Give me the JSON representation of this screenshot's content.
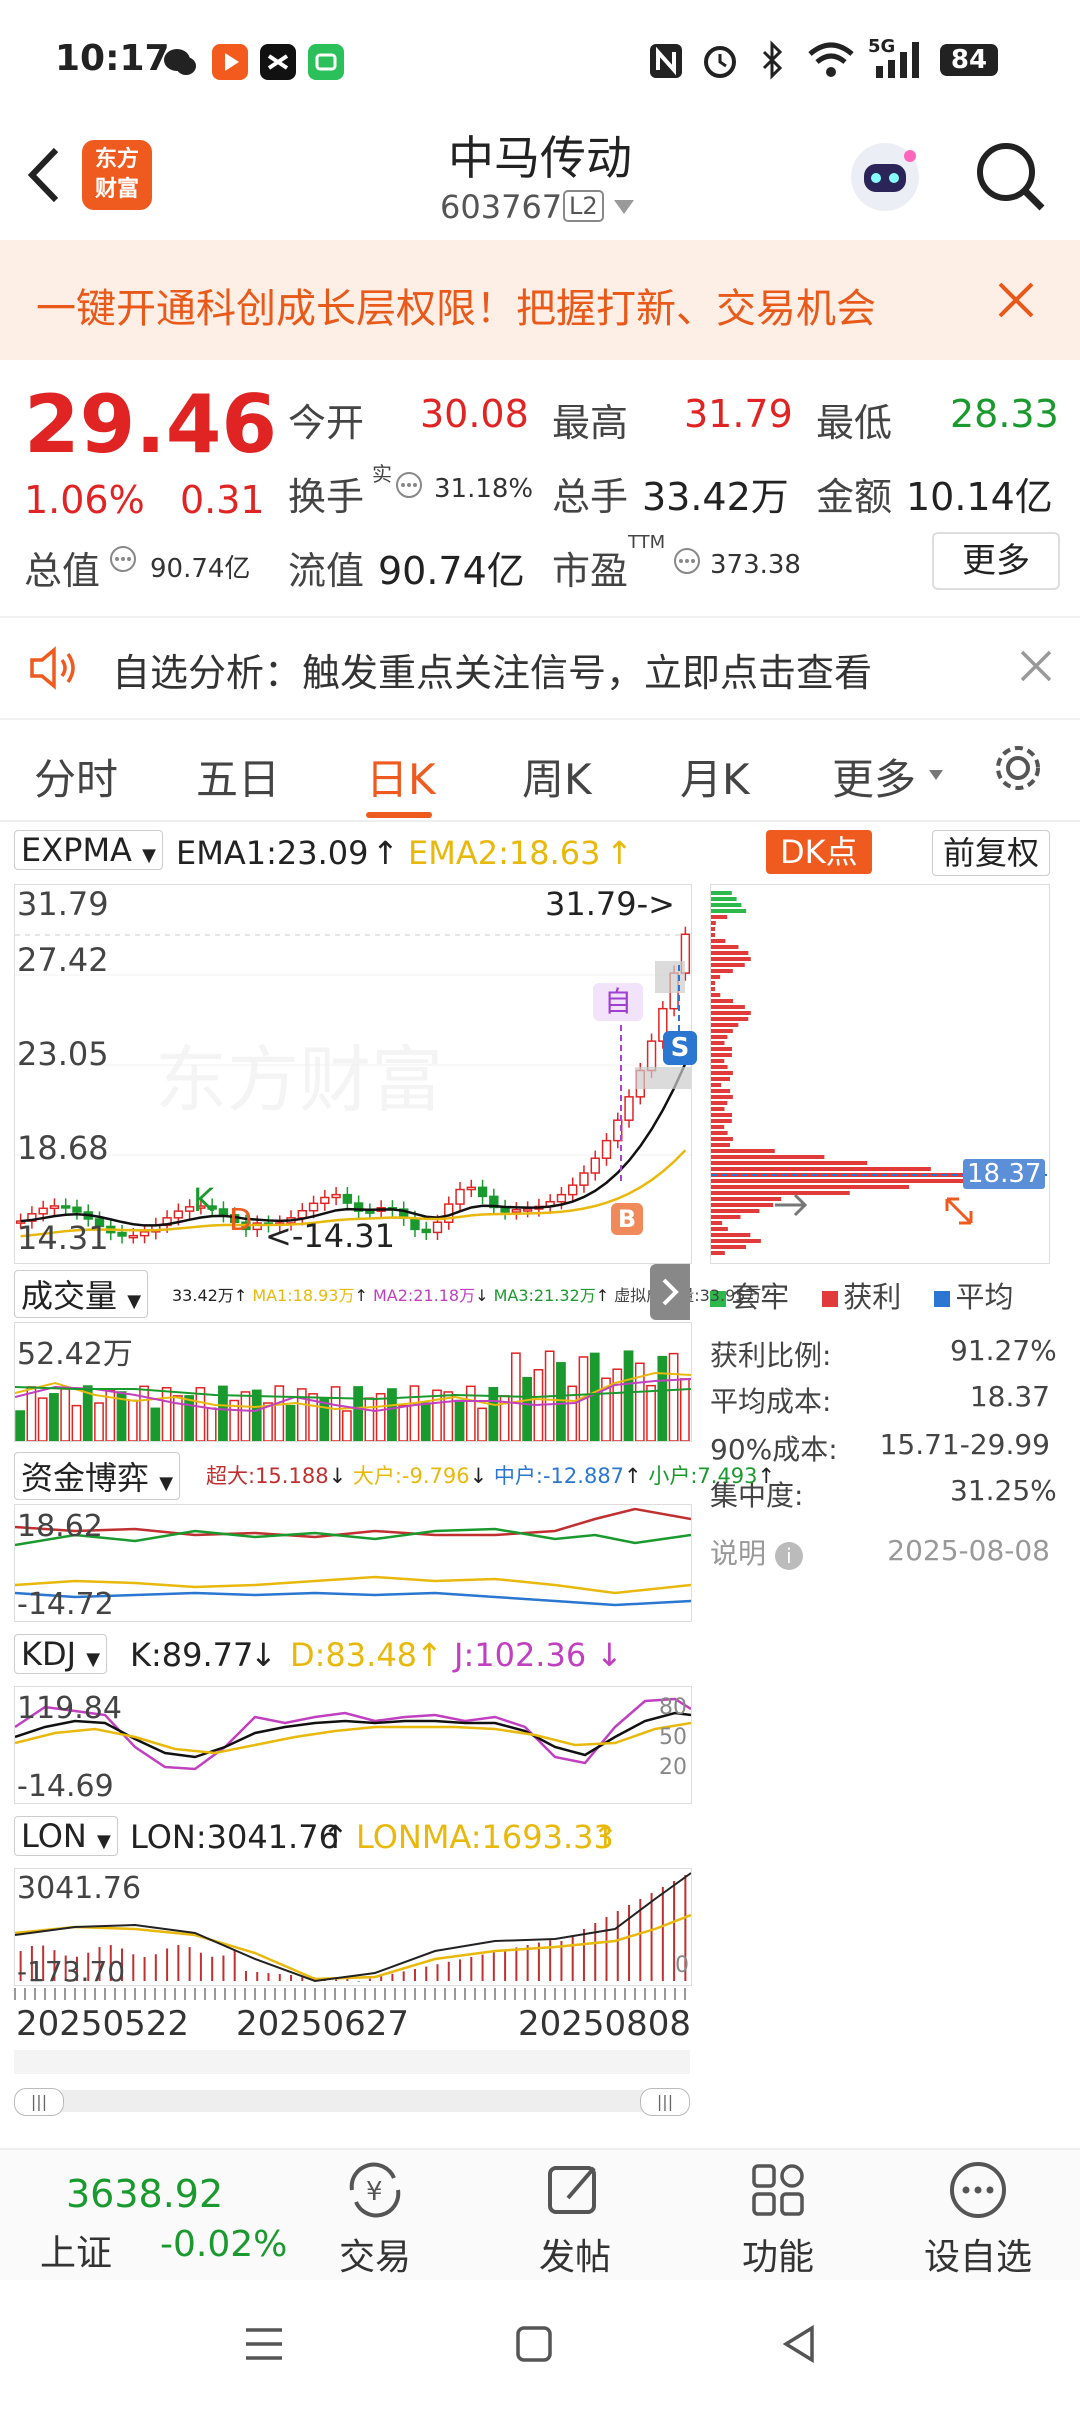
{
  "status_bar": {
    "time": "10:17",
    "battery": "84",
    "network": "5G"
  },
  "header": {
    "logo_text_1": "东方",
    "logo_text_2": "财富",
    "title": "中马传动",
    "code": "603767",
    "badge": "L2"
  },
  "banner": {
    "text": "一键开通科创成长层权限！把握打新、交易机会"
  },
  "quote": {
    "price": "29.46",
    "change_pct": "1.06%",
    "change": "0.31",
    "open_label": "今开",
    "open": "30.08",
    "high_label": "最高",
    "high": "31.79",
    "low_label": "最低",
    "low": "28.33",
    "turnover_label": "换手",
    "turnover_sup": "实",
    "turnover": "31.18%",
    "volume_label": "总手",
    "volume": "33.42万",
    "amount_label": "金额",
    "amount": "10.14亿",
    "mktcap_label": "总值",
    "mktcap": "90.74亿",
    "float_label": "流值",
    "float": "90.74亿",
    "pe_label": "市盈",
    "pe_sup": "TTM",
    "pe": "373.38",
    "more": "更多"
  },
  "notice": {
    "text": "自选分析：触发重点关注信号，立即点击查看"
  },
  "tabs": [
    "分时",
    "五日",
    "日K",
    "周K",
    "月K",
    "更多"
  ],
  "main_chart": {
    "indicator": "EXPMA",
    "ema1": "EMA1:23.09",
    "ema2": "EMA2:18.63",
    "dk_btn": "DK点",
    "adj_btn": "前复权",
    "y_labels": [
      "31.79",
      "27.42",
      "23.05",
      "18.68",
      "14.31"
    ],
    "max_tag": "31.79->",
    "min_tag": "<-14.31",
    "watermark": "东方财富",
    "tag_self": "自",
    "tag_s": "S",
    "tag_b": "B",
    "tag_k": "K",
    "tag_d": "D"
  },
  "chip": {
    "avg_tag": "18.37",
    "legend": [
      "套牢",
      "获利",
      "平均"
    ],
    "rows": [
      {
        "label": "获利比例:",
        "value": "91.27%"
      },
      {
        "label": "平均成本:",
        "value": "18.37"
      },
      {
        "label": "90%成本:",
        "value": "15.71-29.99"
      },
      {
        "label": "集中度:",
        "value": "31.25%"
      }
    ],
    "note": "说明",
    "date": "2025-08-08"
  },
  "volume": {
    "label": "成交量",
    "vals": [
      "33.42万",
      "MA1:18.93万",
      "MA2:21.18万",
      "MA3:21.32万",
      "虚拟成交量:33.95万"
    ],
    "ylab": "52.42万"
  },
  "fund": {
    "label": "资金博弈",
    "vals": [
      "超大:15.188",
      "大户:-9.796",
      "中户:-12.887",
      "小户:7.493"
    ],
    "ytop": "18.62",
    "ybot": "-14.72"
  },
  "kdj": {
    "label": "KDJ",
    "k": "K:89.77",
    "d": "D:83.48",
    "j": "J:102.36",
    "ytop": "119.84",
    "ybot": "-14.69",
    "r80": "80",
    "r50": "50",
    "r20": "20"
  },
  "lon": {
    "label": "LON",
    "lon": "LON:3041.76",
    "lonma": "LONMA:1693.33",
    "ytop": "3041.76",
    "ybot": "-173.70",
    "zero": "0"
  },
  "dates": [
    "20250522",
    "20250627",
    "20250808"
  ],
  "bottom": {
    "index_value": "3638.92",
    "index_name": "上证",
    "index_change": "-0.02%",
    "tabs": [
      "交易",
      "发帖",
      "功能",
      "设自选"
    ]
  },
  "colors": {
    "up": "#e02424",
    "down": "#1a9a2e",
    "accent": "#ef5a1e",
    "ema2": "#e8b90c"
  }
}
